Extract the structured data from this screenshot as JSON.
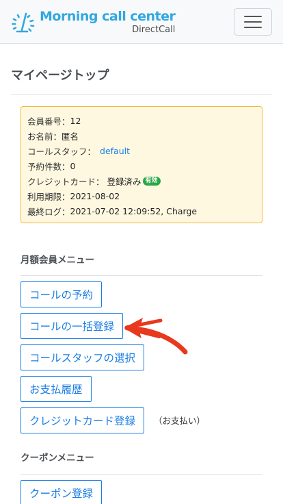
{
  "navbar": {
    "brand_title": "Morning call center",
    "brand_sub": "DirectCall",
    "logo_icon": "sunrise-logo-icon",
    "menu_icon": "hamburger-menu-icon"
  },
  "page": {
    "title": "マイページトップ"
  },
  "member": {
    "number_label": "会員番号：",
    "number_value": "12",
    "name_label": "お名前：",
    "name_value": "匿名",
    "staff_label": "コールスタッフ：",
    "staff_value": "default",
    "reservations_label": "予約件数：",
    "reservations_value": "0",
    "card_label": "クレジットカード：",
    "card_value": "登録済み",
    "card_badge": "有効",
    "expiry_label": "利用期限：",
    "expiry_value": "2021-08-02",
    "last_login_label": "最終ログ：",
    "last_login_value": "2021-07-02 12:09:52, Charge"
  },
  "monthly_menu": {
    "title": "月額会員メニュー",
    "items": [
      {
        "label": "コールの予約"
      },
      {
        "label": "コールの一括登録"
      },
      {
        "label": "コールスタッフの選択"
      },
      {
        "label": "お支払履歴"
      },
      {
        "label": "クレジットカード登録"
      }
    ],
    "card_note": "（お支払い）"
  },
  "coupon_menu": {
    "title": "クーポンメニュー",
    "items": [
      {
        "label": "クーポン登録"
      }
    ]
  },
  "colors": {
    "accent": "#1a7ee6",
    "brand": "#31a8e0",
    "info_bg": "#fff8e1",
    "info_border": "#f0b937",
    "badge": "#28a745",
    "annotation": "#e8381e"
  }
}
